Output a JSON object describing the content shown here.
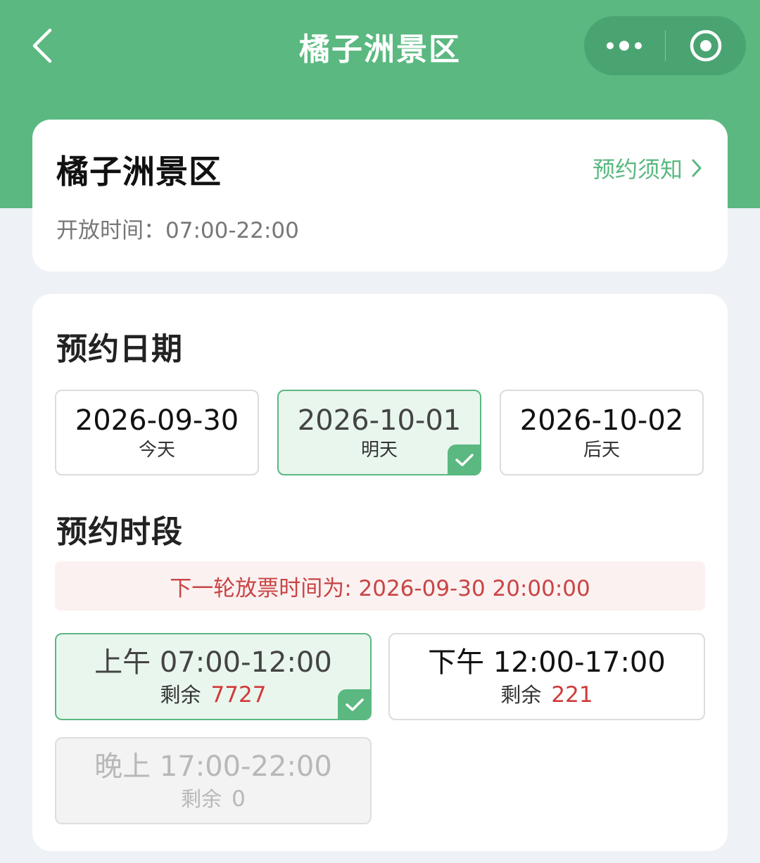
{
  "nav": {
    "title": "橘子洲景区",
    "back_icon": "chevron-left-icon",
    "more_icon": "more-dots-icon",
    "close_icon": "target-close-icon",
    "bar_color": "#5ab880"
  },
  "info": {
    "name": "橘子洲景区",
    "notice_link": "预约须知",
    "open_time": "开放时间：07:00-22:00"
  },
  "booking": {
    "date_title": "预约日期",
    "dates": [
      {
        "date": "2026-09-30",
        "label": "今天",
        "selected": false
      },
      {
        "date": "2026-10-01",
        "label": "明天",
        "selected": true
      },
      {
        "date": "2026-10-02",
        "label": "后天",
        "selected": false
      }
    ],
    "slot_title": "预约时段",
    "release_notice": "下一轮放票时间为: 2026-09-30 20:00:00",
    "remain_label": "剩余",
    "slots": [
      {
        "time": "上午 07:00-12:00",
        "remaining": "7727",
        "selected": true,
        "disabled": false
      },
      {
        "time": "下午 12:00-17:00",
        "remaining": "221",
        "selected": false,
        "disabled": false
      },
      {
        "time": "晚上 17:00-22:00",
        "remaining": "0",
        "selected": false,
        "disabled": true
      }
    ]
  },
  "colors": {
    "accent": "#5ab880",
    "selected_bg": "#e9f6ee",
    "alert_text": "#c94444",
    "alert_bg": "#fbf1f1"
  }
}
